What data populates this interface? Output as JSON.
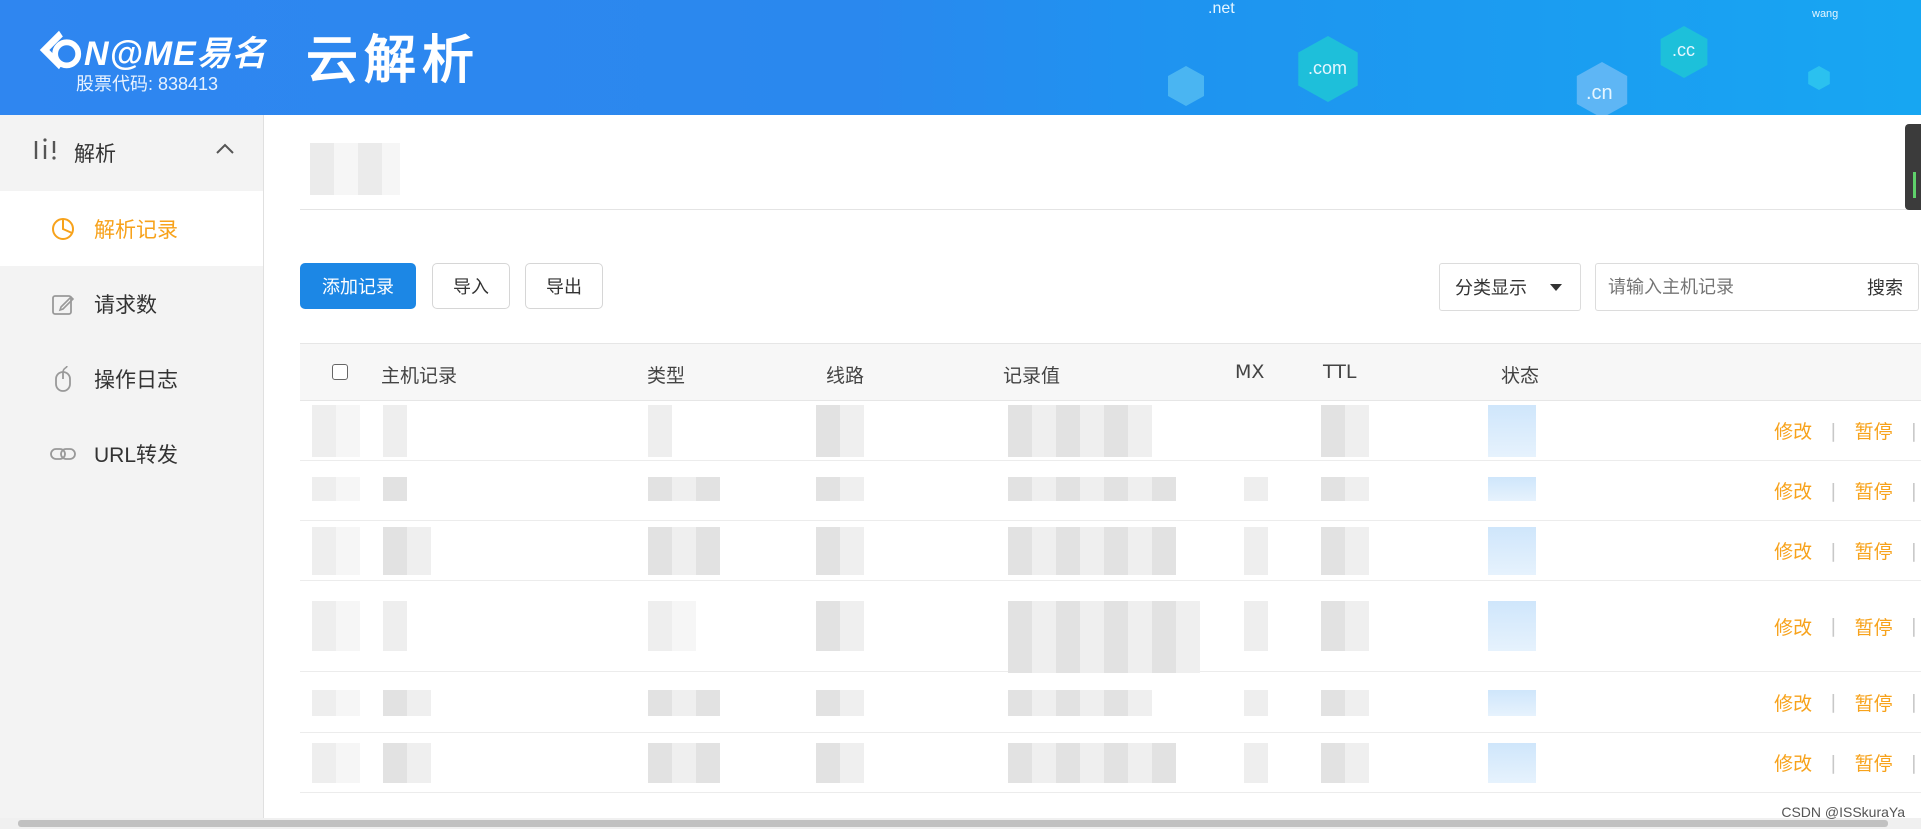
{
  "header": {
    "logo_text": "N@ME易名",
    "stock_code": "股票代码: 838413",
    "product_title": "云解析",
    "tlds": [
      ".net",
      "wang",
      ".com",
      ".cc",
      ".cn"
    ]
  },
  "sidebar": {
    "group_label": "解析",
    "items": [
      {
        "label": "解析记录",
        "icon": "pie-chart-icon",
        "active": true
      },
      {
        "label": "请求数",
        "icon": "edit-icon",
        "active": false
      },
      {
        "label": "操作日志",
        "icon": "mouse-icon",
        "active": false
      },
      {
        "label": "URL转发",
        "icon": "link-icon",
        "active": false
      }
    ]
  },
  "toolbar": {
    "add_label": "添加记录",
    "import_label": "导入",
    "export_label": "导出",
    "category_select": "分类显示",
    "search_placeholder": "请输入主机记录",
    "search_label": "搜索"
  },
  "table": {
    "columns": [
      "主机记录",
      "类型",
      "线路",
      "记录值",
      "MX",
      "TTL",
      "状态"
    ],
    "row_action_edit": "修改",
    "row_action_pause": "暂停",
    "row_count_visible": 6
  },
  "watermark": "CSDN @ISSkuraYa",
  "colors": {
    "accent": "#f7a21b",
    "primary": "#1c87e5",
    "header_blue": "#2f86f0"
  }
}
